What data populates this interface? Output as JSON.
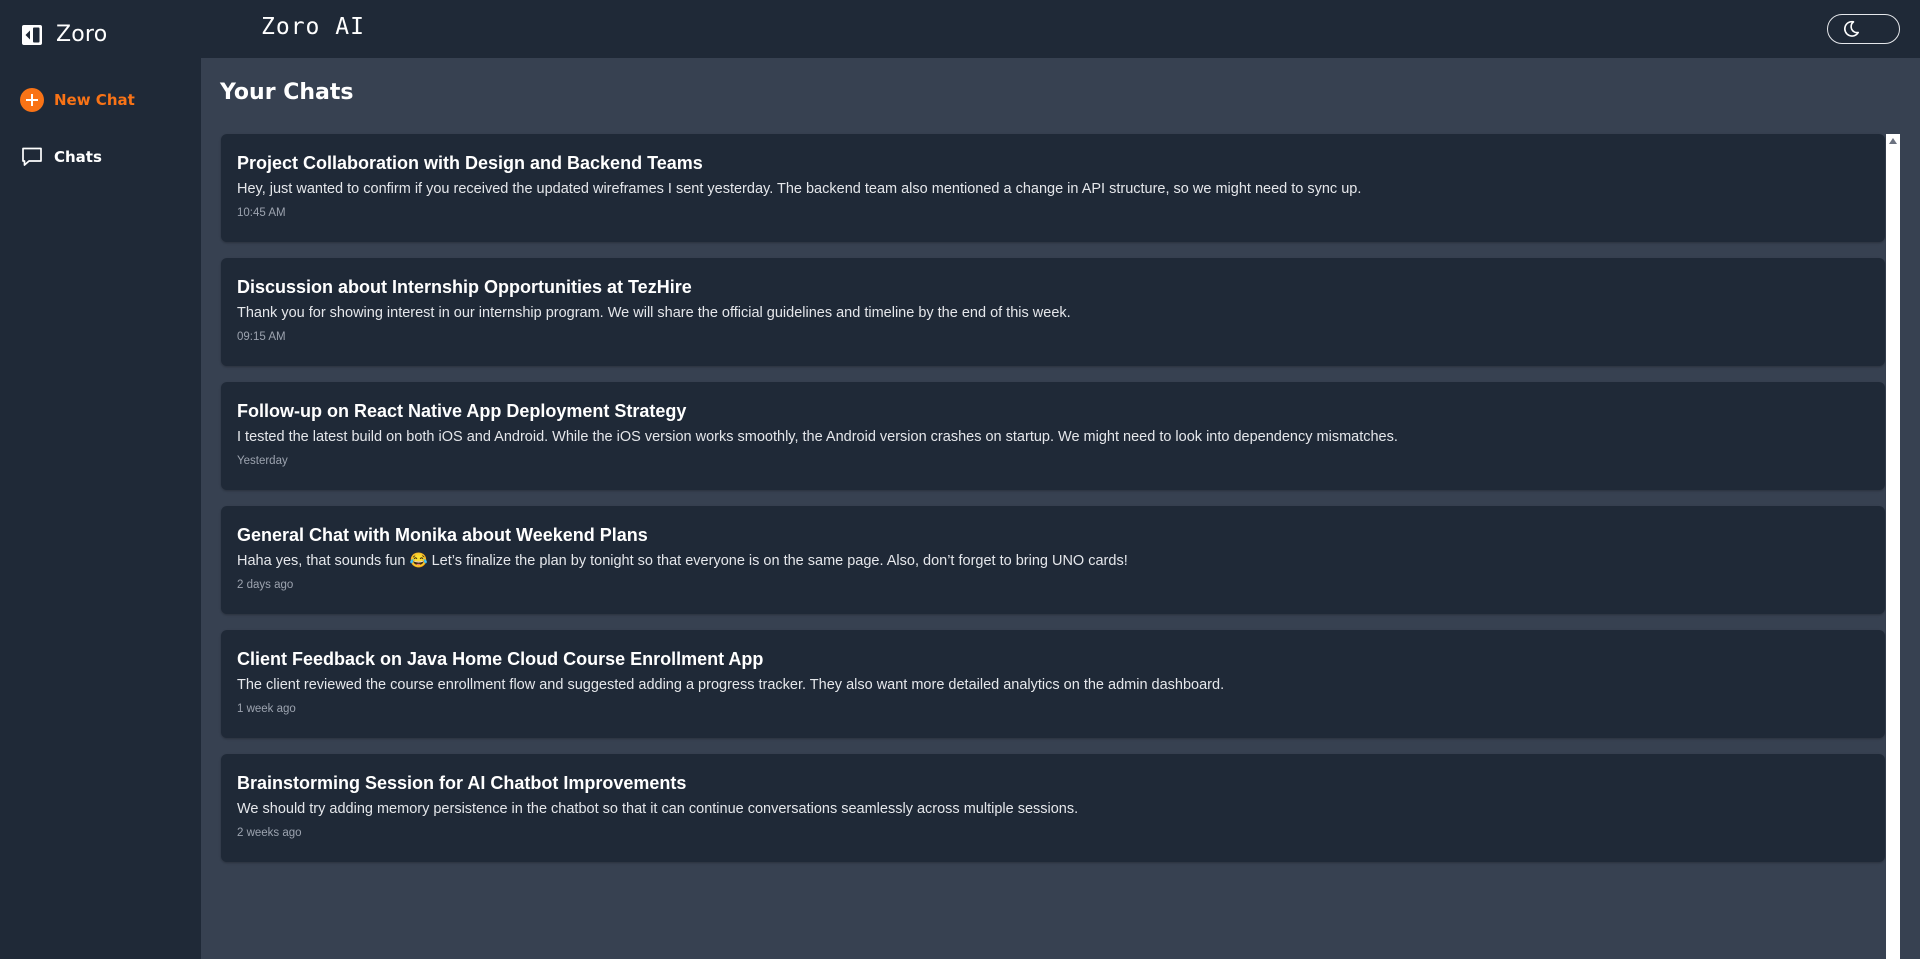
{
  "sidebar": {
    "brand": "Zoro",
    "new_chat_label": "New Chat",
    "chats_label": "Chats",
    "accent_color": "#f97316"
  },
  "header": {
    "title": "Zoro AI",
    "theme_toggle_icon": "moon-icon"
  },
  "main": {
    "page_title": "Your Chats",
    "chats": [
      {
        "title": "Project Collaboration with Design and Backend Teams",
        "preview": "Hey, just wanted to confirm if you received the updated wireframes I sent yesterday. The backend team also mentioned a change in API structure, so we might need to sync up.",
        "time": "10:45 AM"
      },
      {
        "title": "Discussion about Internship Opportunities at TezHire",
        "preview": "Thank you for showing interest in our internship program. We will share the official guidelines and timeline by the end of this week.",
        "time": "09:15 AM"
      },
      {
        "title": "Follow-up on React Native App Deployment Strategy",
        "preview": "I tested the latest build on both iOS and Android. While the iOS version works smoothly, the Android version crashes on startup. We might need to look into dependency mismatches.",
        "time": "Yesterday"
      },
      {
        "title": "General Chat with Monika about Weekend Plans",
        "preview": "Haha yes, that sounds fun 😂 Let’s finalize the plan by tonight so that everyone is on the same page. Also, don’t forget to bring UNO cards!",
        "time": "2 days ago"
      },
      {
        "title": "Client Feedback on Java Home Cloud Course Enrollment App",
        "preview": "The client reviewed the course enrollment flow and suggested adding a progress tracker. They also want more detailed analytics on the admin dashboard.",
        "time": "1 week ago"
      },
      {
        "title": "Brainstorming Session for AI Chatbot Improvements",
        "preview": "We should try adding memory persistence in the chatbot so that it can continue conversations seamlessly across multiple sessions.",
        "time": "2 weeks ago"
      }
    ]
  }
}
